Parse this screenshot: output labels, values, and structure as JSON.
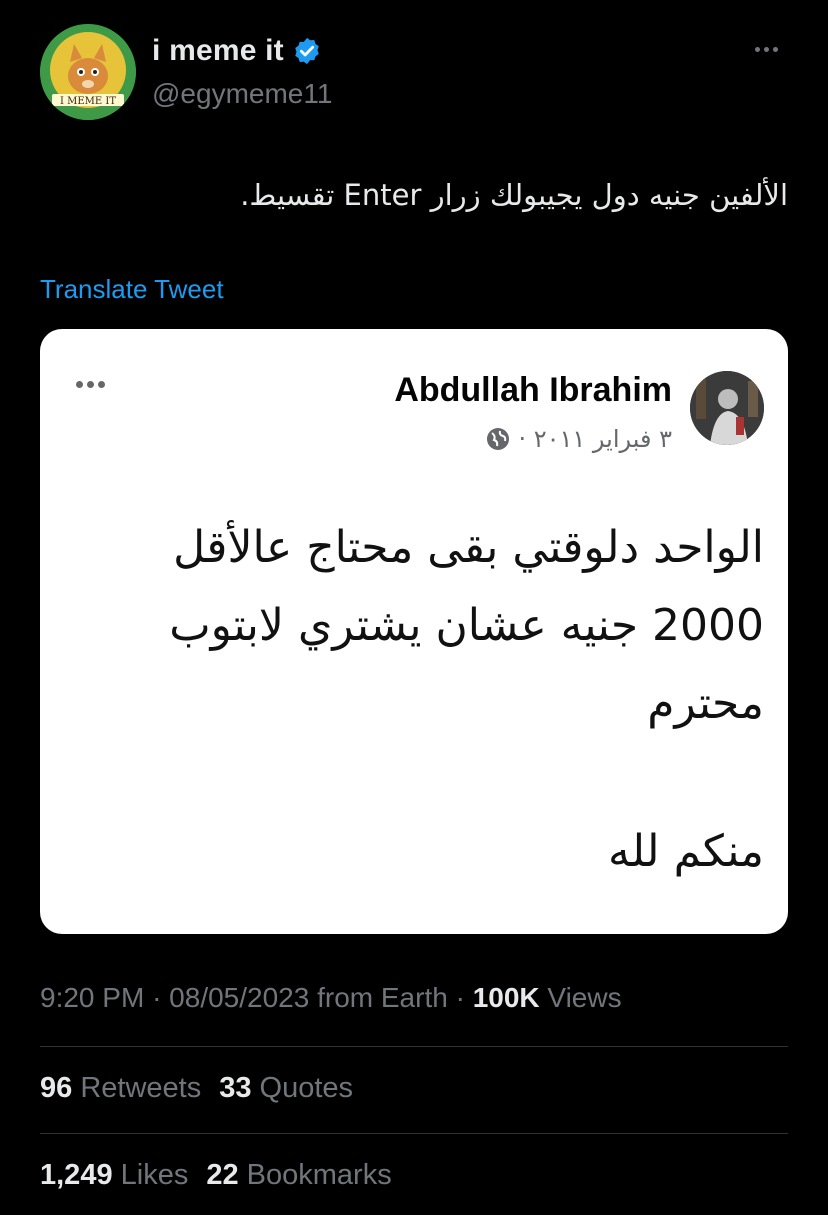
{
  "author": {
    "name": "i meme it",
    "handle": "@egymeme11",
    "avatar_text": "I MEME IT"
  },
  "tweet": {
    "text": "الألفين جنيه دول يجيبولك زرار Enter تقسيط.",
    "translate_label": "Translate Tweet"
  },
  "embedded_post": {
    "name": "Abdullah Ibrahim",
    "date": "٣ فبراير ٢٠١١ ·",
    "lines": [
      "الواحد دلوقتي بقى محتاج عالأقل",
      "2000 جنيه عشان يشتري لابتوب",
      "محترم",
      "منكم لله"
    ]
  },
  "meta": {
    "time": "9:20 PM",
    "date": "08/05/2023",
    "source": "from Earth",
    "sep1": "·",
    "sep2": "·",
    "views_count": "100K",
    "views_label": "Views"
  },
  "stats": {
    "retweets_count": "96",
    "retweets_label": "Retweets",
    "quotes_count": "33",
    "quotes_label": "Quotes",
    "likes_count": "1,249",
    "likes_label": "Likes",
    "bookmarks_count": "22",
    "bookmarks_label": "Bookmarks"
  },
  "colors": {
    "background": "#000000",
    "link": "#1d9bf0",
    "verified": "#1d9bf0",
    "muted": "#71767b"
  },
  "icons": [
    "more-icon",
    "verified-icon",
    "globe-icon"
  ]
}
